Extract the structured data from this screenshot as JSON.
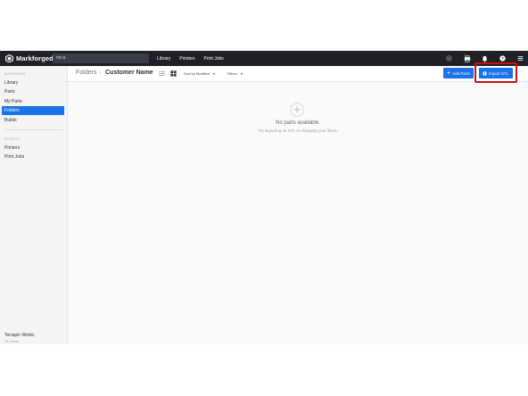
{
  "topbar": {
    "brand": "Markforged",
    "search_value": "mica",
    "nav": [
      "Library",
      "Printers",
      "Print Jobs"
    ],
    "icons": [
      "status-icon",
      "printer-icon",
      "bell-icon",
      "help-icon",
      "menu-icon"
    ]
  },
  "sidebar": {
    "workspace_label": "WORKSPACE",
    "workspace_items": [
      "Library",
      "Parts",
      "My Parts",
      "Folders",
      "Builds"
    ],
    "active_item": "Folders",
    "activity_label": "ACTIVITY",
    "activity_items": [
      "Printers",
      "Print Jobs"
    ],
    "org_name": "Terrapin Works",
    "org_sub": "75 Users"
  },
  "header": {
    "breadcrumb_root": "Folders",
    "breadcrumb_sep": "›",
    "breadcrumb_current": "Customer Name",
    "sort_label": "Sort by Modified",
    "filters_label": "Filters",
    "add_parts_label": "Add Parts",
    "import_stl_label": "Import STL",
    "more_label": "···"
  },
  "empty_state": {
    "title": "No parts available.",
    "subtitle": "Try importing an STL or changing your filters."
  },
  "colors": {
    "topbar": "#1f2126",
    "accent": "#1a73e8",
    "highlight": "#c4121a"
  }
}
